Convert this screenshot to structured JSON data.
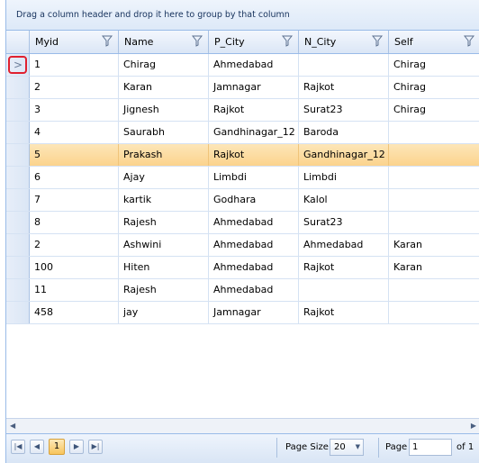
{
  "group_panel": {
    "text": "Drag a column header and drop it here to group by that column"
  },
  "columns": [
    "Myid",
    "Name",
    "P_City",
    "N_City",
    "Self"
  ],
  "rows": [
    [
      "1",
      "Chirag",
      "Ahmedabad",
      "",
      "Chirag"
    ],
    [
      "2",
      "Karan",
      "Jamnagar",
      "Rajkot",
      "Chirag"
    ],
    [
      "3",
      "Jignesh",
      "Rajkot",
      "Surat23",
      "Chirag"
    ],
    [
      "4",
      "Saurabh",
      "Gandhinagar_12",
      "Baroda",
      ""
    ],
    [
      "5",
      "Prakash",
      "Rajkot",
      "Gandhinagar_12",
      ""
    ],
    [
      "6",
      "Ajay",
      "Limbdi",
      "Limbdi",
      ""
    ],
    [
      "7",
      "kartik",
      "Godhara",
      "Kalol",
      ""
    ],
    [
      "8",
      "Rajesh",
      "Ahmedabad",
      "Surat23",
      ""
    ],
    [
      "2",
      "Ashwini",
      "Ahmedabad",
      "Ahmedabad",
      "Karan"
    ],
    [
      "100",
      "Hiten",
      "Ahmedabad",
      "Rajkot",
      "Karan"
    ],
    [
      "11",
      "Rajesh",
      "Ahmedabad",
      "",
      ""
    ],
    [
      "458",
      "jay",
      "Jamnagar",
      "Rajkot",
      ""
    ]
  ],
  "current_row_index": 0,
  "selected_row_index": 4,
  "pager": {
    "current_page": "1",
    "page_size_label": "Page Size",
    "page_size_value": "20",
    "page_label": "Page",
    "page_input_value": "1",
    "of_label": "of 1"
  },
  "icons": {
    "current_row": "chevron-right-icon",
    "filter": "funnel-icon",
    "first": "first-page-icon",
    "prev": "prev-page-icon",
    "next": "next-page-icon",
    "last": "last-page-icon"
  },
  "colors": {
    "selected_row": "#fbd38d",
    "current_indicator_border": "#e0202f",
    "header_border": "#99bbe8"
  }
}
